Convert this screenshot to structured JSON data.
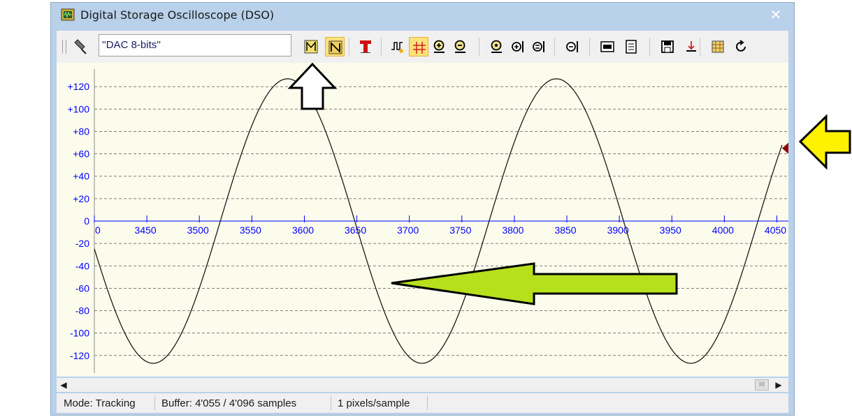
{
  "window": {
    "title": "Digital Storage Oscilloscope (DSO)",
    "close_label": "✕"
  },
  "toolbar": {
    "channel_value": "''DAC 8-bits''",
    "buttons": [
      {
        "name": "channel-select-icon",
        "active": false
      },
      {
        "name": "auto-trigger-icon",
        "active": true
      },
      {
        "name": "trigger-marker-icon",
        "active": false
      },
      {
        "name": "signal-view-icon",
        "active": false
      },
      {
        "name": "cursors-icon",
        "active": true
      },
      {
        "name": "zoom-in-icon",
        "active": false
      },
      {
        "name": "zoom-out-icon",
        "active": false
      },
      {
        "name": "zoom-reset-icon",
        "active": false
      },
      {
        "name": "zoom-x-in-icon",
        "active": false
      },
      {
        "name": "zoom-x-fit-icon",
        "active": false
      },
      {
        "name": "zoom-x-out-icon",
        "active": false
      },
      {
        "name": "memory-icon",
        "active": false
      },
      {
        "name": "copy-icon",
        "active": false
      },
      {
        "name": "save-icon",
        "active": false
      },
      {
        "name": "export-icon",
        "active": false
      },
      {
        "name": "settings-icon",
        "active": false
      },
      {
        "name": "refresh-icon",
        "active": false
      }
    ]
  },
  "chart_data": {
    "type": "line",
    "y_ticks": [
      "+120",
      "+100",
      "+80",
      "+60",
      "+40",
      "+20",
      "0",
      "-20",
      "-40",
      "-60",
      "-80",
      "-100",
      "-120"
    ],
    "x_ticks": [
      "0",
      "3450",
      "3500",
      "3550",
      "3600",
      "3650",
      "3700",
      "3750",
      "3800",
      "3850",
      "3900",
      "3950",
      "4000",
      "4050"
    ],
    "xlim": [
      3400,
      4055
    ],
    "ylim": [
      -127,
      127
    ],
    "series": [
      {
        "amplitude": 127,
        "period_samples": 256,
        "peak_at": 3584,
        "x_start": 3400,
        "x_end": 4055
      }
    ],
    "trigger_marker_value": 65,
    "grid": true
  },
  "colors": {
    "trace": "#1a1a1a",
    "axis_labels": "#0000ff",
    "marker": "#8b0000",
    "active_button": "#fde27a",
    "yellow_arrow": "#fff200",
    "green_arrow": "#b7e01c"
  },
  "status": {
    "mode": "Mode: Tracking",
    "buffer": "Buffer:  4'055 / 4'096 samples",
    "scale": "1 pixels/sample"
  }
}
